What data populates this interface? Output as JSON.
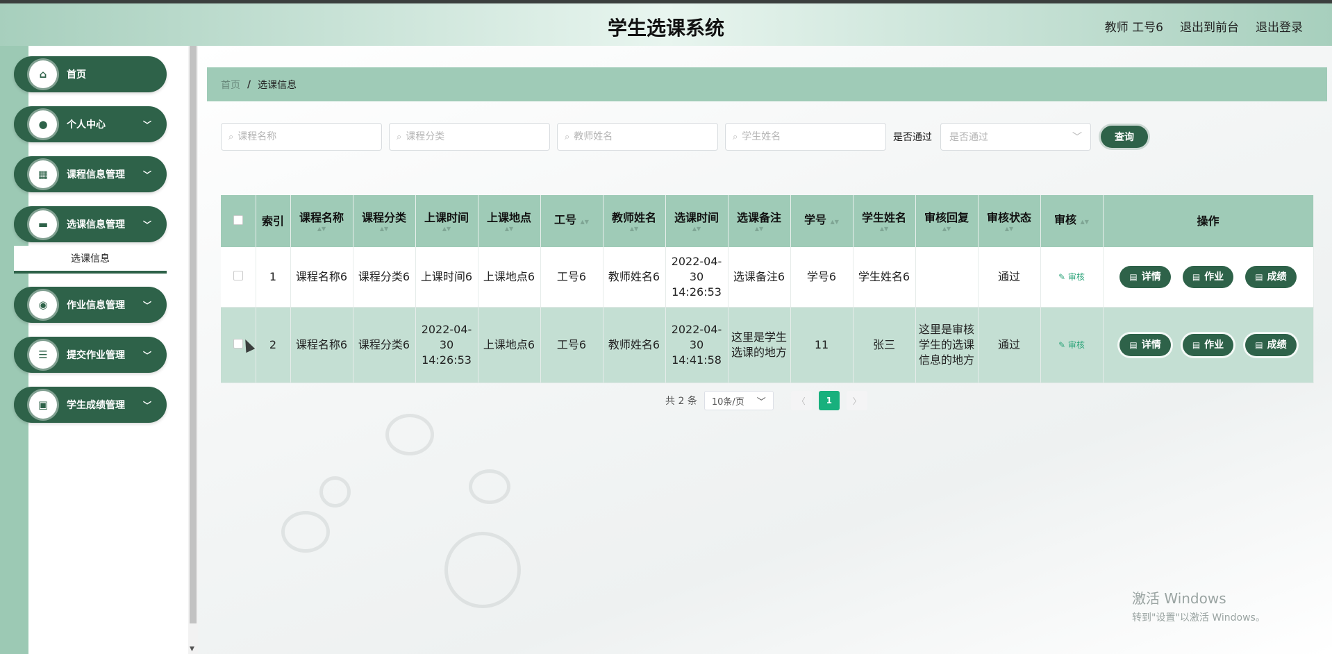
{
  "header": {
    "title": "学生选课系统",
    "user": "教师 工号6",
    "front": "退出到前台",
    "logout": "退出登录"
  },
  "sidebar": {
    "items": [
      {
        "label": "首页",
        "icon": "home-icon"
      },
      {
        "label": "个人中心",
        "icon": "user-icon"
      },
      {
        "label": "课程信息管理",
        "icon": "grid-icon"
      },
      {
        "label": "选课信息管理",
        "icon": "monitor-icon"
      },
      {
        "label": "作业信息管理",
        "icon": "location-icon"
      },
      {
        "label": "提交作业管理",
        "icon": "list-icon"
      },
      {
        "label": "学生成绩管理",
        "icon": "briefcase-icon"
      }
    ],
    "submenu": "选课信息"
  },
  "breadcrumb": {
    "home": "首页",
    "sep": "/",
    "current": "选课信息"
  },
  "search": {
    "course_name": "课程名称",
    "course_category": "课程分类",
    "teacher_name": "教师姓名",
    "student_name": "学生姓名",
    "pass_label": "是否通过",
    "pass_placeholder": "是否通过",
    "query": "查询"
  },
  "table": {
    "headers": [
      "索引",
      "课程名称",
      "课程分类",
      "上课时间",
      "上课地点",
      "工号",
      "教师姓名",
      "选课时间",
      "选课备注",
      "学号",
      "学生姓名",
      "审核回复",
      "审核状态",
      "审核",
      "操作"
    ],
    "audit_label": "审核",
    "actions": {
      "detail": "详情",
      "homework": "作业",
      "score": "成绩"
    },
    "rows": [
      {
        "index": "1",
        "course": "课程名称6",
        "category": "课程分类6",
        "time": "上课时间6",
        "place": "上课地点6",
        "teacher_id": "工号6",
        "teacher": "教师姓名6",
        "select_time": "2022-04-30 14:26:53",
        "remark": "选课备注6",
        "student_id": "学号6",
        "student": "学生姓名6",
        "reply": "",
        "status": "通过"
      },
      {
        "index": "2",
        "course": "课程名称6",
        "category": "课程分类6",
        "time": "2022-04-30 14:26:53",
        "place": "上课地点6",
        "teacher_id": "工号6",
        "teacher": "教师姓名6",
        "select_time": "2022-04-30 14:41:58",
        "remark": "这里是学生选课的地方",
        "student_id": "11",
        "student": "张三",
        "reply": "这里是审核学生的选课信息的地方",
        "status": "通过"
      }
    ]
  },
  "pagination": {
    "total": "共 2 条",
    "page_size": "10条/页",
    "current": "1"
  },
  "watermark": {
    "line1": "激活 Windows",
    "line2": "转到\"设置\"以激活 Windows。"
  }
}
